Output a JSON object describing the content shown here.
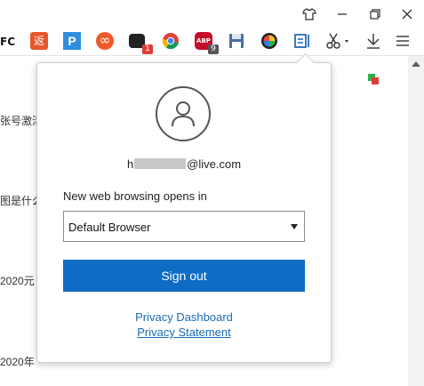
{
  "titlebar": {
    "icons": [
      "tshirt-icon",
      "minimize-icon",
      "restore-icon",
      "close-icon"
    ]
  },
  "toolbar": {
    "extensions": [
      {
        "name": "fc-icon",
        "text": "FC"
      },
      {
        "name": "rebate-icon",
        "text": "返",
        "color": "#e8562a"
      },
      {
        "name": "p-icon",
        "text": "P",
        "color": "#2f8ee0"
      },
      {
        "name": "infinity-icon",
        "text": "∞",
        "color": "#f05a28"
      },
      {
        "name": "game-controller-icon",
        "badge": "1",
        "badge_color": "#e23b3b"
      },
      {
        "name": "chrome-icon"
      },
      {
        "name": "adblock-icon",
        "text": "ABP",
        "badge": "9",
        "badge_color": "#555555"
      },
      {
        "name": "floppy-disk-icon",
        "color": "#4a6da7"
      },
      {
        "name": "color-picker-icon"
      },
      {
        "name": "edge-profile-icon",
        "color": "#2b6cb5"
      }
    ],
    "right_icons": [
      "scissors-icon",
      "download-icon",
      "menu-icon"
    ]
  },
  "background_page": {
    "lines": [
      "张号激活",
      "图是什么",
      "2020元",
      "2020年"
    ]
  },
  "popup": {
    "email_prefix": "h",
    "email_suffix": "@live.com",
    "open_label": "New web browsing opens in",
    "select_value": "Default Browser",
    "sign_out": "Sign out",
    "privacy_dashboard": "Privacy Dashboard",
    "privacy_statement": "Privacy Statement"
  },
  "colors": {
    "accent": "#0e6cc4",
    "link": "#1a6bb3"
  }
}
